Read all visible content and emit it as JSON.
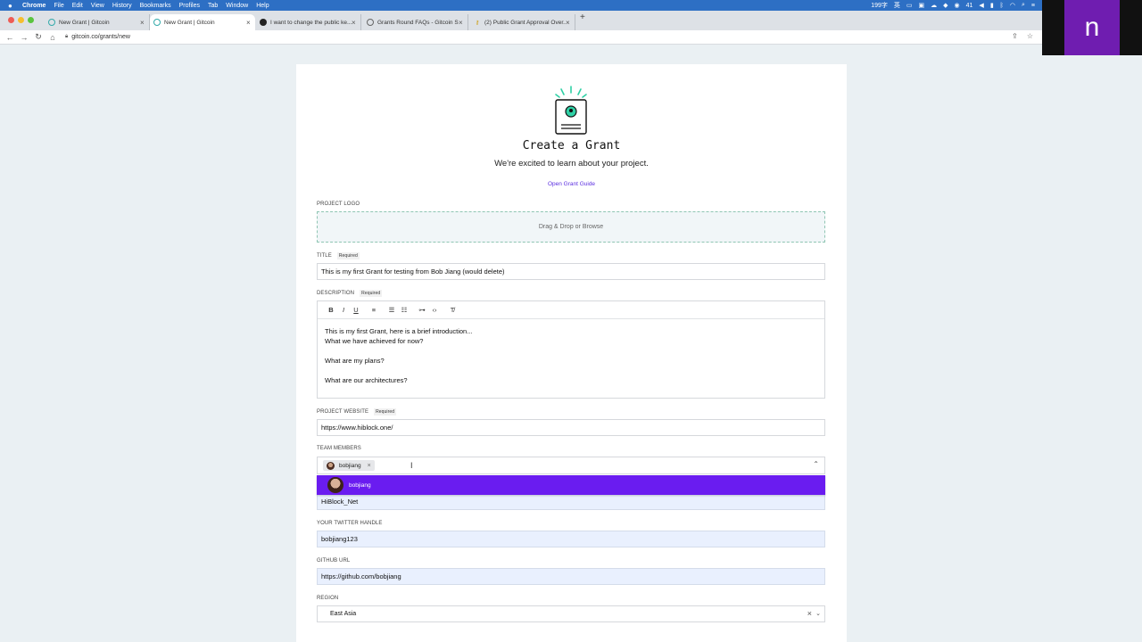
{
  "menubar": {
    "app": "Chrome",
    "items": [
      "File",
      "Edit",
      "View",
      "History",
      "Bookmarks",
      "Profiles",
      "Tab",
      "Window",
      "Help"
    ],
    "status_text": "199字",
    "status_ime": "英",
    "status_count": "41"
  },
  "tabs": [
    {
      "title": "New Grant | Gitcoin"
    },
    {
      "title": "New Grant | Gitcoin"
    },
    {
      "title": "I want to change the public ke..."
    },
    {
      "title": "Grants Round FAQs - Gitcoin S..."
    },
    {
      "title": "(2) Public Grant Approval Over..."
    }
  ],
  "address": {
    "url": "gitcoin.co/grants/new"
  },
  "overlay_letter": "n",
  "page": {
    "title": "Create a Grant",
    "subtitle": "We're excited to learn about your project.",
    "guide_link": "Open Grant Guide",
    "required_tag": "Required"
  },
  "form": {
    "logo_label": "PROJECT LOGO",
    "dropzone": "Drag & Drop or Browse",
    "title_label": "TITLE",
    "title_value": "This is my first Grant for testing from Bob Jiang (would delete)",
    "description_label": "DESCRIPTION",
    "description_lines": [
      "This is my first Grant, here is a brief introduction...",
      "What we have achieved for now?",
      "What are my plans?",
      "What are our architectures?"
    ],
    "website_label": "PROJECT WEBSITE",
    "website_value": "https://www.hiblock.one/",
    "team_label": "TEAM MEMBERS",
    "team_chip": "bobjiang",
    "team_option": "bobjiang",
    "hidden_value": "HiBlock_Net",
    "twitter_label": "YOUR TWITTER HANDLE",
    "twitter_value": "bobjiang123",
    "github_label": "GITHUB URL",
    "github_value": "https://github.com/bobjiang",
    "region_label": "REGION",
    "region_value": "East Asia"
  }
}
